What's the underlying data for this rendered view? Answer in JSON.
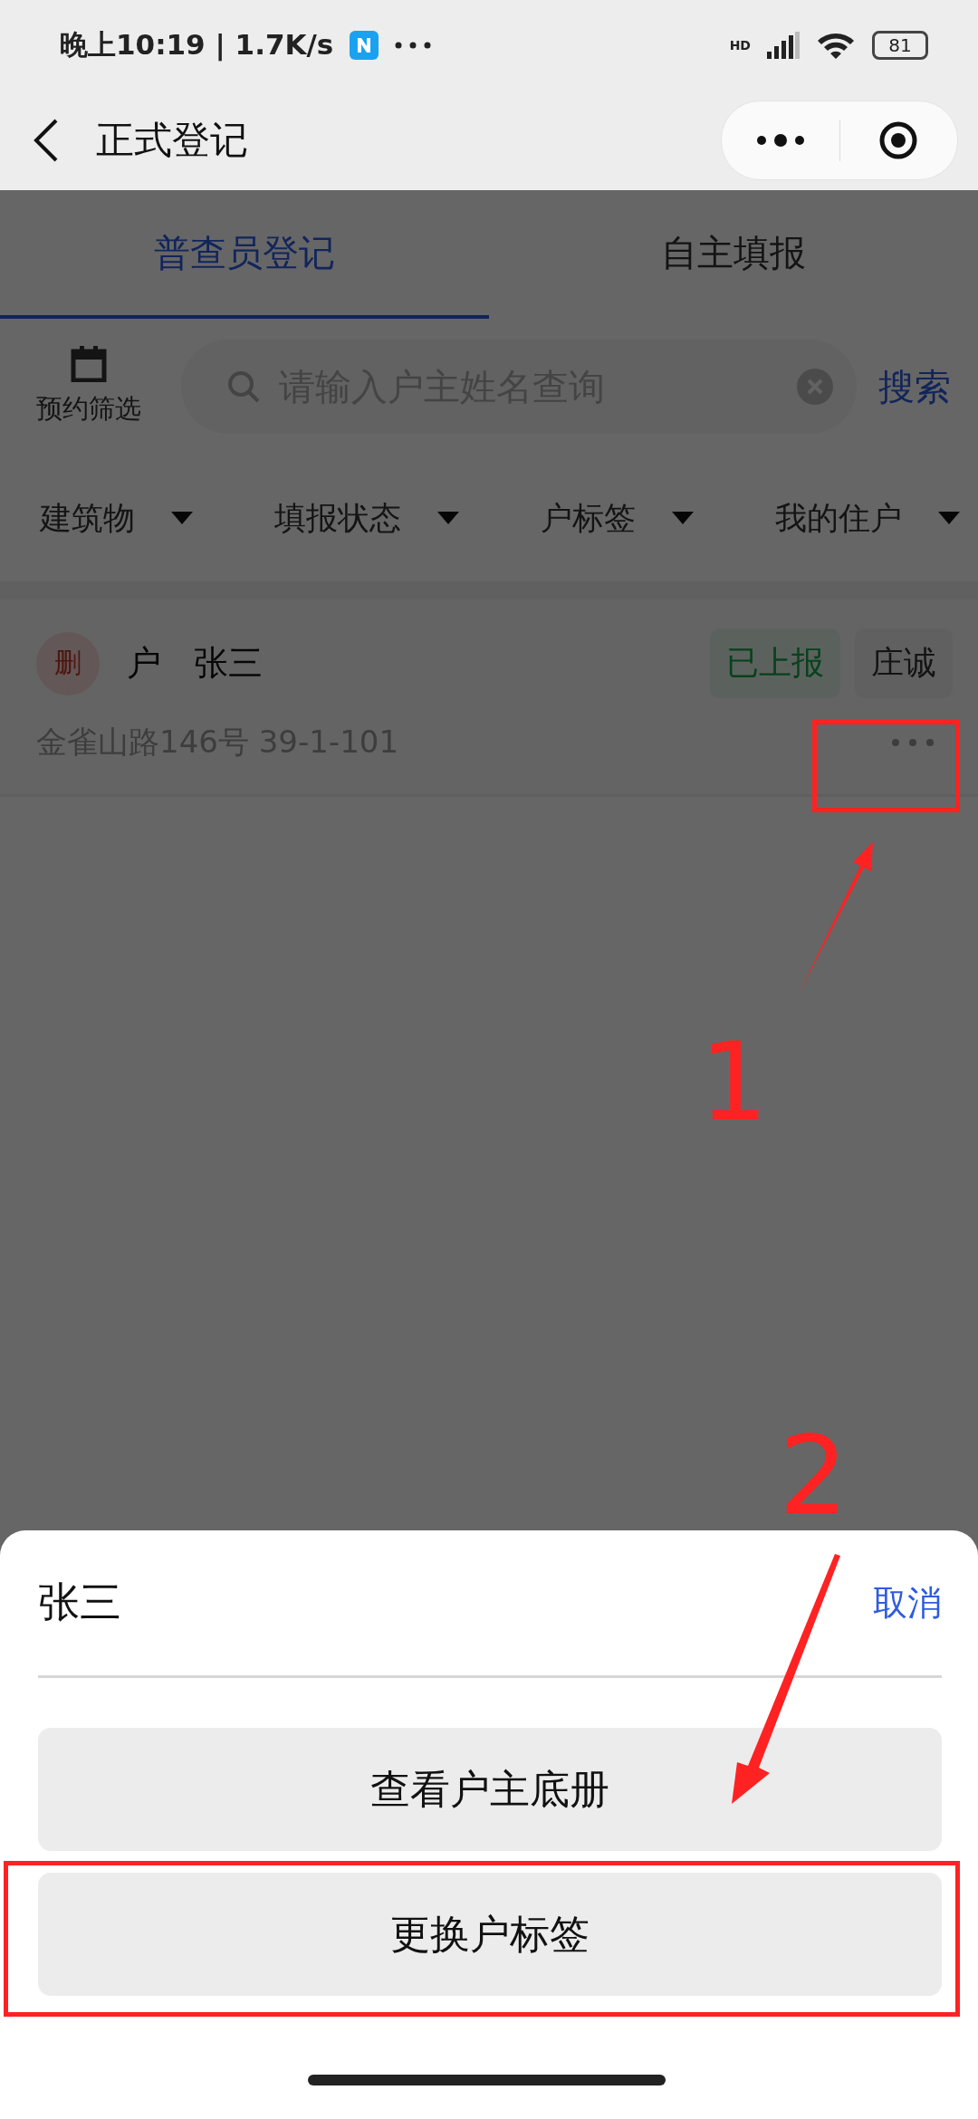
{
  "status_bar": {
    "time": "晚上10:19 | 1.7K/s",
    "signal_label": "HD",
    "battery": "81"
  },
  "nav": {
    "title": "正式登记"
  },
  "tabs": [
    {
      "label": "普查员登记",
      "selected": true
    },
    {
      "label": "自主填报",
      "selected": false
    }
  ],
  "toolbar": {
    "filter_label": "预约筛选",
    "search": {
      "placeholder": "请输入户主姓名查询"
    },
    "search_button": "搜索"
  },
  "filters": [
    {
      "label": "建筑物"
    },
    {
      "label": "填报状态"
    },
    {
      "label": "户标签"
    },
    {
      "label": "我的住户"
    }
  ],
  "households": [
    {
      "badge": "删",
      "type": "户",
      "name": "张三",
      "status": "已上报",
      "enumerator": "庄诚",
      "address": "金雀山路146号 39-1-101"
    }
  ],
  "sheet": {
    "title": "张三",
    "cancel": "取消",
    "actions": [
      "查看户主底册",
      "更换户标签"
    ]
  },
  "annotations": [
    {
      "number": "1"
    },
    {
      "number": "2"
    }
  ]
}
